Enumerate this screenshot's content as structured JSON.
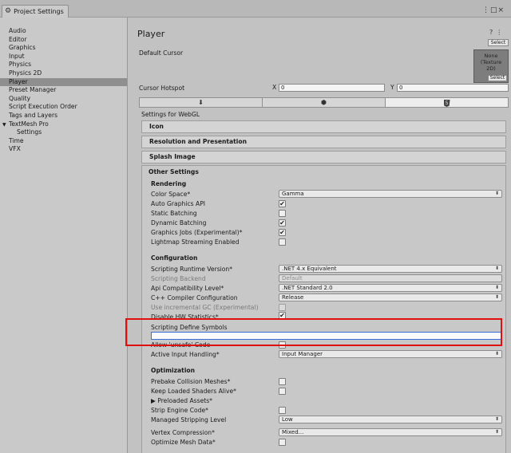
{
  "window": {
    "tab_title": "Project Settings",
    "menu_glyph": "⋮□×"
  },
  "sidebar": {
    "items": [
      {
        "label": "Audio"
      },
      {
        "label": "Editor"
      },
      {
        "label": "Graphics"
      },
      {
        "label": "Input"
      },
      {
        "label": "Physics"
      },
      {
        "label": "Physics 2D"
      },
      {
        "label": "Player",
        "selected": true
      },
      {
        "label": "Preset Manager"
      },
      {
        "label": "Quality"
      },
      {
        "label": "Script Execution Order"
      },
      {
        "label": "Tags and Layers"
      },
      {
        "label": "TextMesh Pro",
        "expanded": true
      },
      {
        "label": "Settings",
        "child": true
      },
      {
        "label": "Time"
      },
      {
        "label": "VFX"
      }
    ]
  },
  "header": {
    "title": "Player",
    "select_label": "Select"
  },
  "cursor": {
    "default_label": "Default Cursor",
    "texture_text": "None\n(Texture\n2D)",
    "texture_select": "Select",
    "hotspot_label": "Cursor Hotspot",
    "x_label": "X",
    "x_value": "0",
    "y_label": "Y",
    "y_value": "0"
  },
  "platform_tabs": [
    {
      "icon": "download-icon"
    },
    {
      "icon": "android-icon"
    },
    {
      "icon": "html5-icon",
      "active": true
    }
  ],
  "settings_for": "Settings for WebGL",
  "sections": {
    "icon": "Icon",
    "resolution": "Resolution and Presentation",
    "splash": "Splash Image",
    "other": "Other Settings"
  },
  "rendering": {
    "title": "Rendering",
    "color_space_label": "Color Space*",
    "color_space_value": "Gamma",
    "auto_graphics_label": "Auto Graphics API",
    "auto_graphics": true,
    "static_batching_label": "Static Batching",
    "static_batching": false,
    "dynamic_batching_label": "Dynamic Batching",
    "dynamic_batching": true,
    "graphics_jobs_label": "Graphics Jobs (Experimental)*",
    "graphics_jobs": true,
    "lightmap_label": "Lightmap Streaming Enabled",
    "lightmap": false
  },
  "configuration": {
    "title": "Configuration",
    "runtime_label": "Scripting Runtime Version*",
    "runtime_value": ".NET 4.x Equivalent",
    "backend_label": "Scripting Backend",
    "backend_value": "Default",
    "api_label": "Api Compatibility Level*",
    "api_value": ".NET Standard 2.0",
    "cpp_label": "C++ Compiler Configuration",
    "cpp_value": "Release",
    "gc_label": "Use incremental GC (Experimental)",
    "hw_label": "Disable HW Statistics*",
    "define_label": "Scripting Define Symbols",
    "define_value": "",
    "unsafe_label": "Allow 'unsafe' Code",
    "input_label": "Active Input Handling*",
    "input_value": "Input Manager"
  },
  "optimization": {
    "title": "Optimization",
    "prebake_label": "Prebake Collision Meshes*",
    "keep_shaders_label": "Keep Loaded Shaders Alive*",
    "preloaded_label": "Preloaded Assets*",
    "strip_label": "Strip Engine Code*",
    "stripping_label": "Managed Stripping Level",
    "stripping_value": "Low",
    "vertex_label": "Vertex Compression*",
    "vertex_value": "Mixed...",
    "optimize_mesh_label": "Optimize Mesh Data*"
  },
  "colors": {
    "highlight": "#e01010",
    "focus": "#3d6dd6"
  }
}
